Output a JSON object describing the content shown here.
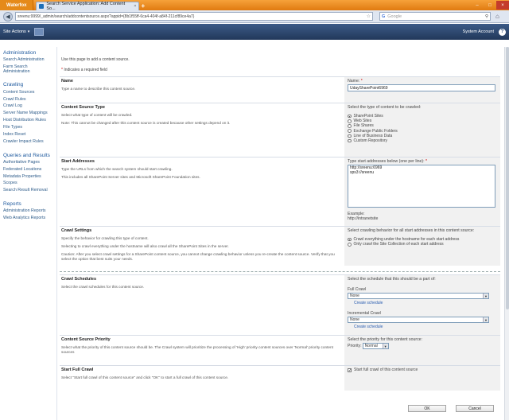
{
  "browser": {
    "brand": "Waterfox",
    "tab_title": "Search Service Application: Add Content So...",
    "url": "sreenu:9999/_admin/search/addcontentsource.aspx?appid={8b1f55ff-6ca4-404f-a84f-211cf89ce4a7}",
    "search_placeholder": "Google"
  },
  "ribbon": {
    "site_actions": "Site Actions",
    "system_account": "System Account",
    "help": "?"
  },
  "leftnav": {
    "administration": {
      "heading": "Administration",
      "items": [
        "Search Administration",
        "Farm Search Administration"
      ]
    },
    "crawling": {
      "heading": "Crawling",
      "items": [
        "Content Sources",
        "Crawl Rules",
        "Crawl Log",
        "Server Name Mappings",
        "Host Distribution Rules",
        "File Types",
        "Index Reset",
        "Crawler Impact Rules"
      ]
    },
    "queries": {
      "heading": "Queries and Results",
      "items": [
        "Authoritative Pages",
        "Federated Locations",
        "Metadata Properties",
        "Scopes",
        "Search Result Removal"
      ]
    },
    "reports": {
      "heading": "Reports",
      "items": [
        "Administration Reports",
        "Web Analytics Reports"
      ]
    }
  },
  "page": {
    "intro": "Use this page to add a content source.",
    "required_note": "Indicates a required field",
    "required_star": "*"
  },
  "name_section": {
    "title": "Name",
    "desc": "Type a name to describe this content source.",
    "field_label": "Name:",
    "value": "UdaySharePoint6969"
  },
  "type_section": {
    "title": "Content Source Type",
    "desc1": "Select what type of content will be crawled.",
    "desc2": "Note: This cannot be changed after this content source is created because other settings depend on it.",
    "prompt": "Select the type of content to be crawled:",
    "options": [
      "SharePoint Sites",
      "Web Sites",
      "File Shares",
      "Exchange Public Folders",
      "Line of Business Data",
      "Custom Repository"
    ],
    "selected_index": 0
  },
  "start_section": {
    "title": "Start Addresses",
    "desc1": "Type the URLs from which the search system should start crawling.",
    "desc2": "This includes all SharePoint Server sites and Microsoft SharePoint Foundation sites.",
    "field_label": "Type start addresses below (one per line):",
    "lines": [
      "http://sreenu:6969",
      "sps3://sreenu"
    ],
    "example_label": "Example:",
    "example_value": "http://intranetsite"
  },
  "crawl_settings": {
    "title": "Crawl Settings",
    "desc1": "Specify the behavior for crawling this type of content.",
    "desc2": "Selecting to crawl everything under the hostname will also crawl all the SharePoint Sites in the server.",
    "desc3": "Caution: After you select crawl settings for a SharePoint content source, you cannot change crawling behavior unless you re-create the content source. Verify that you select the option that best suits your needs.",
    "prompt": "Select crawling behavior for all start addresses in this content source:",
    "options": [
      "Crawl everything under the hostname for each start address",
      "Only crawl the Site Collection of each start address"
    ],
    "selected_index": 0
  },
  "schedules": {
    "title": "Crawl Schedules",
    "desc": "Select the crawl schedules for this content source.",
    "prompt": "Select the schedule that this should be a part of:",
    "full_label": "Full Crawl",
    "full_value": "None",
    "incremental_label": "Incremental Crawl",
    "incremental_value": "None",
    "create_link": "Create schedule"
  },
  "priority": {
    "title": "Content Source Priority",
    "desc": "Select what the priority of this content source should be. The Crawl system will prioritize the processing of 'High' priority content sources over 'Normal' priority content sources",
    "prompt": "Select the priority for this content source:",
    "label": "Priority:",
    "value": "Normal"
  },
  "full_crawl": {
    "title": "Start Full Crawl",
    "desc": "Select \"Start full crawl of this content source\" and click \"OK\" to start a full crawl of this content source.",
    "checkbox_label": "Start full crawl of this content source",
    "checked": true
  },
  "buttons": {
    "ok": "OK",
    "cancel": "Cancel"
  }
}
